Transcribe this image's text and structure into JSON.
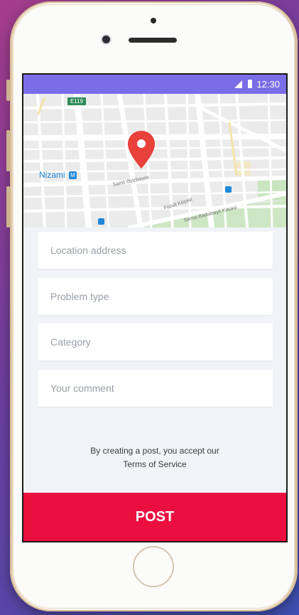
{
  "status_bar": {
    "time": "12:30"
  },
  "map": {
    "labels": {
      "highway": "E119",
      "district": "Nizami",
      "metro_badge": "M",
      "street_1": "Samil Əzizbəyov",
      "street_2": "Füzuli Küçəsi",
      "street_3": "Səmsi Bədəlbəyli Küçəsi"
    },
    "pin_icon": "location-pin-icon"
  },
  "form": {
    "location_placeholder": "Location address",
    "problem_placeholder": "Problem type",
    "category_placeholder": "Category",
    "comment_placeholder": "Your comment"
  },
  "terms": {
    "line1": "By creating a post, you accept our",
    "line2": "Terms of Service"
  },
  "post_button": {
    "label": "POST"
  },
  "colors": {
    "status_bar": "#7b6ce8",
    "accent": "#ea0f3e",
    "pin": "#e8403a",
    "background": "#f1f3f6"
  }
}
